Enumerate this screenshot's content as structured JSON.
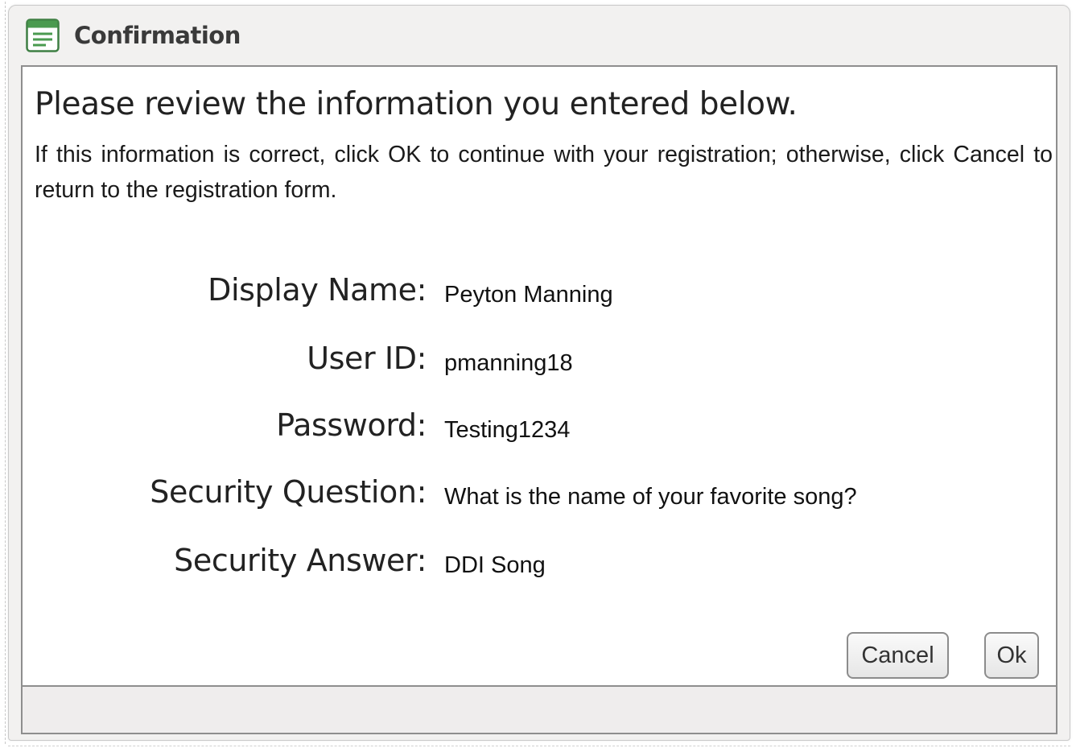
{
  "window": {
    "title": "Confirmation",
    "title_icon": "form-window-icon"
  },
  "dialog": {
    "heading": "Please review the information you entered below.",
    "instructions": "If this information is correct, click OK to continue with your registration; otherwise, click Cancel to return to the registration form."
  },
  "fields": [
    {
      "label": "Display Name:",
      "value": "Peyton Manning"
    },
    {
      "label": "User ID:",
      "value": "pmanning18"
    },
    {
      "label": "Password:",
      "value": "Testing1234"
    },
    {
      "label": "Security Question:",
      "value": "What is the name of your favorite song?"
    },
    {
      "label": "Security Answer:",
      "value": "DDI Song"
    }
  ],
  "buttons": {
    "cancel_label": "Cancel",
    "ok_label": "Ok"
  },
  "colors": {
    "icon_green": "#4a9a4f",
    "window_bg": "#f2f1f0",
    "panel_border": "#8e8e8e"
  }
}
